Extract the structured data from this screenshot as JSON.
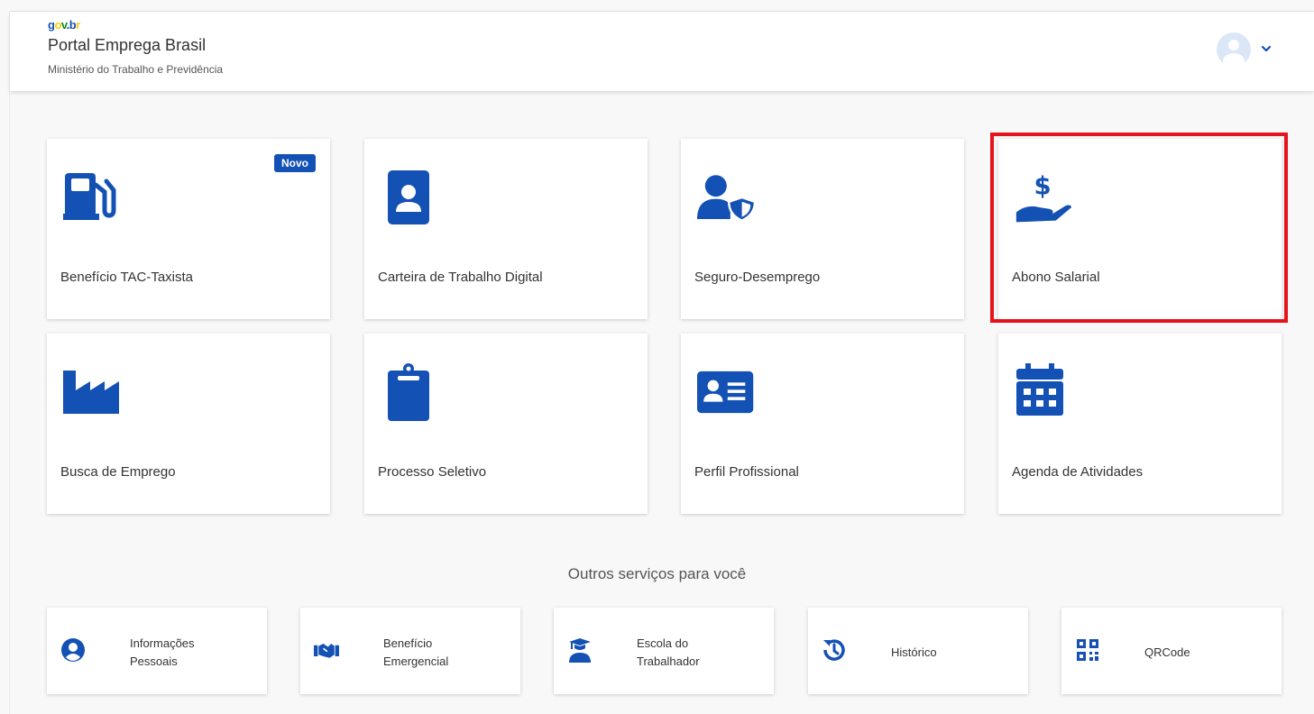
{
  "header": {
    "logo": "gov.br",
    "title": "Portal Emprega Brasil",
    "subtitle": "Ministério do Trabalho e Previdência"
  },
  "cards": [
    {
      "label": "Benefício TAC-Taxista",
      "icon": "gas-pump-icon",
      "badge": "Novo"
    },
    {
      "label": "Carteira de Trabalho Digital",
      "icon": "id-badge-icon"
    },
    {
      "label": "Seguro-Desemprego",
      "icon": "user-shield-icon"
    },
    {
      "label": "Abono Salarial",
      "icon": "hand-dollar-icon"
    },
    {
      "label": "Busca de Emprego",
      "icon": "industry-icon"
    },
    {
      "label": "Processo Seletivo",
      "icon": "clipboard-icon"
    },
    {
      "label": "Perfil Profissional",
      "icon": "address-card-icon"
    },
    {
      "label": "Agenda de Atividades",
      "icon": "calendar-icon"
    }
  ],
  "other_services": {
    "title": "Outros serviços para você",
    "items": [
      {
        "line1": "Informações",
        "line2": "Pessoais",
        "icon": "user-circle-icon"
      },
      {
        "line1": "Benefício",
        "line2": "Emergencial",
        "icon": "handshake-icon"
      },
      {
        "line1": "Escola do",
        "line2": "Trabalhador",
        "icon": "graduate-icon"
      },
      {
        "line1": "Histórico",
        "line2": "",
        "icon": "history-icon"
      },
      {
        "line1": "QRCode",
        "line2": "",
        "icon": "qrcode-icon"
      }
    ]
  },
  "colors": {
    "primary": "#1351b4",
    "highlight": "#e5141c"
  }
}
